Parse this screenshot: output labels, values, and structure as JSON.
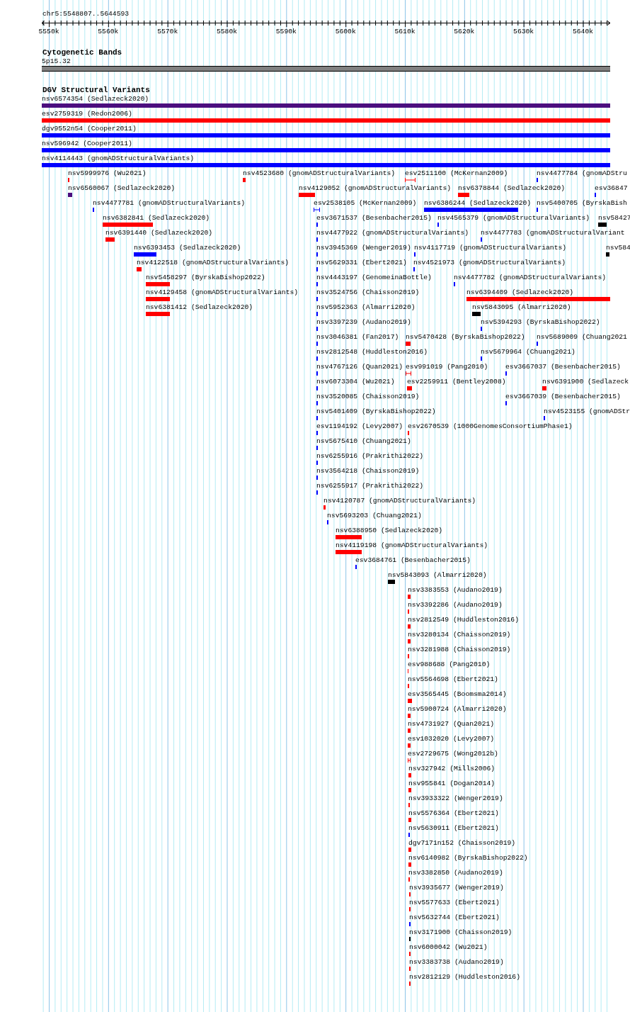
{
  "view": {
    "locus": "chr5:5548807..5644593"
  },
  "ruler": {
    "ticks": [
      "5550k",
      "5560k",
      "5570k",
      "5580k",
      "5590k",
      "5600k",
      "5610k",
      "5620k",
      "5630k",
      "5640k"
    ]
  },
  "cytobands": {
    "title": "Cytogenetic Bands",
    "bands": [
      {
        "label": "5p15.32",
        "color": "#808080"
      }
    ]
  },
  "variants": {
    "title": "DGV Structural Variants",
    "rows": [
      [
        {
          "label": "nsv6574354 (Sedlazeck2020)",
          "color": "#4b0f7f",
          "kind": "bar"
        }
      ],
      [
        {
          "label": "esv2759319 (Redon2006)",
          "color": "#ff0000",
          "kind": "bar"
        }
      ],
      [
        {
          "label": "dgv9552n54 (Cooper2011)",
          "color": "#0000ff",
          "kind": "bar"
        }
      ],
      [
        {
          "label": "nsv596942 (Cooper2011)",
          "color": "#0000ff",
          "kind": "bar"
        }
      ],
      [
        {
          "label": "nsv4114443 (gnomADStructuralVariants)",
          "color": "#0000ff",
          "kind": "bar"
        }
      ],
      [
        {
          "label": "nsv5999976 (Wu2021)",
          "color": "#ff0000",
          "kind": "bar"
        },
        {
          "label": "nsv4523680 (gnomADStructuralVariants)",
          "color": "#ff0000",
          "kind": "bar"
        },
        {
          "label": "esv2511100 (McKernan2009)",
          "color": "#ff0000",
          "kind": "range"
        },
        {
          "label": "nsv4477784 (gnomADStru",
          "color": "#0000ff",
          "kind": "bar"
        }
      ],
      [
        {
          "label": "nsv6560067 (Sedlazeck2020)",
          "color": "#4b0f7f",
          "kind": "bar"
        },
        {
          "label": "nsv4129052 (gnomADStructuralVariants)",
          "color": "#ff0000",
          "kind": "bar"
        },
        {
          "label": "nsv6378844 (Sedlazeck2020)",
          "color": "#ff0000",
          "kind": "bar"
        },
        {
          "label": "esv36847",
          "color": "#0000ff",
          "kind": "bar"
        }
      ],
      [
        {
          "label": "nsv4477781 (gnomADStructuralVariants)",
          "color": "#0000ff",
          "kind": "bar"
        },
        {
          "label": "esv2538105 (McKernan2009)",
          "color": "#0000ff",
          "kind": "range"
        },
        {
          "label": "nsv6386244 (Sedlazeck2020)",
          "color": "#0000ff",
          "kind": "bar"
        },
        {
          "label": "nsv5400705 (ByrskaBish",
          "color": "#0000ff",
          "kind": "bar"
        }
      ],
      [
        {
          "label": "nsv6382841 (Sedlazeck2020)",
          "color": "#ff0000",
          "kind": "bar"
        },
        {
          "label": "esv3671537 (Besenbacher2015)",
          "color": "#0000ff",
          "kind": "bar"
        },
        {
          "label": "nsv4565379 (gnomADStructuralVariants)",
          "color": "#0000ff",
          "kind": "bar"
        },
        {
          "label": "nsv58427",
          "color": "#000000",
          "kind": "bar"
        }
      ],
      [
        {
          "label": "nsv6391440 (Sedlazeck2020)",
          "color": "#ff0000",
          "kind": "bar"
        },
        {
          "label": "nsv4477922 (gnomADStructuralVariants)",
          "color": "#0000ff",
          "kind": "bar"
        },
        {
          "label": "nsv4477783 (gnomADStructuralVariant",
          "color": "#0000ff",
          "kind": "bar"
        }
      ],
      [
        {
          "label": "nsv6393453 (Sedlazeck2020)",
          "color": "#0000ff",
          "kind": "bar"
        },
        {
          "label": "nsv3945369 (Wenger2019)",
          "color": "#0000ff",
          "kind": "bar"
        },
        {
          "label": "nsv4117719 (gnomADStructuralVariants)",
          "color": "#0000ff",
          "kind": "bar"
        },
        {
          "label": "nsv584",
          "color": "#000000",
          "kind": "bar"
        }
      ],
      [
        {
          "label": "nsv4122518 (gnomADStructuralVariants)",
          "color": "#ff0000",
          "kind": "bar"
        },
        {
          "label": "nsv5629331 (Ebert2021)",
          "color": "#0000ff",
          "kind": "bar"
        },
        {
          "label": "nsv4521973 (gnomADStructuralVariants)",
          "color": "#0000ff",
          "kind": "bar"
        }
      ],
      [
        {
          "label": "nsv5458297 (ByrskaBishop2022)",
          "color": "#ff0000",
          "kind": "bar"
        },
        {
          "label": "nsv4443197 (GenomeinaBottle)",
          "color": "#0000ff",
          "kind": "bar"
        },
        {
          "label": "nsv4477782 (gnomADStructuralVariants)",
          "color": "#0000ff",
          "kind": "bar"
        }
      ],
      [
        {
          "label": "nsv4129458 (gnomADStructuralVariants)",
          "color": "#ff0000",
          "kind": "bar"
        },
        {
          "label": "nsv3524756 (Chaisson2019)",
          "color": "#0000ff",
          "kind": "bar"
        },
        {
          "label": "nsv6394409 (Sedlazeck2020)",
          "color": "#ff0000",
          "kind": "bar"
        }
      ],
      [
        {
          "label": "nsv6381412 (Sedlazeck2020)",
          "color": "#ff0000",
          "kind": "bar"
        },
        {
          "label": "nsv5952363 (Almarri2020)",
          "color": "#0000ff",
          "kind": "bar"
        },
        {
          "label": "nsv5843095 (Almarri2020)",
          "color": "#000000",
          "kind": "bar"
        }
      ],
      [
        {
          "label": "nsv3397239 (Audano2019)",
          "color": "#0000ff",
          "kind": "bar"
        },
        {
          "label": "nsv5394293 (ByrskaBishop2022)",
          "color": "#0000ff",
          "kind": "bar"
        }
      ],
      [
        {
          "label": "nsv3046381 (Fan2017)",
          "color": "#0000ff",
          "kind": "bar"
        },
        {
          "label": "nsv5470428 (ByrskaBishop2022)",
          "color": "#ff0000",
          "kind": "bar"
        },
        {
          "label": "nsv5689009 (Chuang2021",
          "color": "#0000ff",
          "kind": "bar"
        }
      ],
      [
        {
          "label": "nsv2812548 (Huddleston2016)",
          "color": "#0000ff",
          "kind": "bar"
        },
        {
          "label": "nsv5679964 (Chuang2021)",
          "color": "#0000ff",
          "kind": "bar"
        }
      ],
      [
        {
          "label": "nsv4767126 (Quan2021)",
          "color": "#0000ff",
          "kind": "bar"
        },
        {
          "label": "esv991019 (Pang2010)",
          "color": "#ff0000",
          "kind": "range"
        },
        {
          "label": "esv3667037 (Besenbacher2015)",
          "color": "#0000ff",
          "kind": "bar"
        }
      ],
      [
        {
          "label": "nsv6073304 (Wu2021)",
          "color": "#0000ff",
          "kind": "bar"
        },
        {
          "label": "esv2259911 (Bentley2008)",
          "color": "#ff0000",
          "kind": "bar"
        },
        {
          "label": "nsv6391900 (Sedlazeck",
          "color": "#ff0000",
          "kind": "bar"
        }
      ],
      [
        {
          "label": "nsv3520085 (Chaisson2019)",
          "color": "#0000ff",
          "kind": "bar"
        },
        {
          "label": "esv3667039 (Besenbacher2015)",
          "color": "#0000ff",
          "kind": "bar"
        }
      ],
      [
        {
          "label": "nsv5401409 (ByrskaBishop2022)",
          "color": "#0000ff",
          "kind": "bar"
        },
        {
          "label": "nsv4523155 (gnomADStr",
          "color": "#0000ff",
          "kind": "bar"
        }
      ],
      [
        {
          "label": "esv1194192 (Levy2007)",
          "color": "#0000ff",
          "kind": "bar"
        },
        {
          "label": "esv2670539 (1000GenomesConsortiumPhase1)",
          "color": "#ff0000",
          "kind": "bar"
        }
      ],
      [
        {
          "label": "nsv5675410 (Chuang2021)",
          "color": "#0000ff",
          "kind": "bar"
        }
      ],
      [
        {
          "label": "nsv6255916 (Prakrithi2022)",
          "color": "#0000ff",
          "kind": "bar"
        }
      ],
      [
        {
          "label": "nsv3564218 (Chaisson2019)",
          "color": "#0000ff",
          "kind": "bar"
        }
      ],
      [
        {
          "label": "nsv6255917 (Prakrithi2022)",
          "color": "#0000ff",
          "kind": "bar"
        }
      ],
      [
        {
          "label": "nsv4120787 (gnomADStructuralVariants)",
          "color": "#ff0000",
          "kind": "bar"
        }
      ],
      [
        {
          "label": "nsv5693203 (Chuang2021)",
          "color": "#0000ff",
          "kind": "bar"
        }
      ],
      [
        {
          "label": "nsv6388950 (Sedlazeck2020)",
          "color": "#ff0000",
          "kind": "bar"
        }
      ],
      [
        {
          "label": "nsv4119198 (gnomADStructuralVariants)",
          "color": "#ff0000",
          "kind": "bar"
        }
      ],
      [
        {
          "label": "esv3684761 (Besenbacher2015)",
          "color": "#0000ff",
          "kind": "bar"
        }
      ],
      [
        {
          "label": "nsv5843093 (Almarri2020)",
          "color": "#000000",
          "kind": "bar"
        }
      ],
      [
        {
          "label": "nsv3383553 (Audano2019)",
          "color": "#ff0000",
          "kind": "bar"
        }
      ],
      [
        {
          "label": "nsv3392286 (Audano2019)",
          "color": "#ff0000",
          "kind": "bar"
        }
      ],
      [
        {
          "label": "nsv2812549 (Huddleston2016)",
          "color": "#ff0000",
          "kind": "bar"
        }
      ],
      [
        {
          "label": "nsv3280134 (Chaisson2019)",
          "color": "#ff0000",
          "kind": "bar"
        }
      ],
      [
        {
          "label": "nsv3281988 (Chaisson2019)",
          "color": "#ff0000",
          "kind": "bar"
        }
      ],
      [
        {
          "label": "esv988688 (Pang2010)",
          "color": "#ff0000",
          "kind": "bar"
        }
      ],
      [
        {
          "label": "nsv5564698 (Ebert2021)",
          "color": "#ff0000",
          "kind": "bar"
        }
      ],
      [
        {
          "label": "esv3565445 (Boomsma2014)",
          "color": "#ff0000",
          "kind": "bar"
        }
      ],
      [
        {
          "label": "nsv5900724 (Almarri2020)",
          "color": "#ff0000",
          "kind": "bar"
        }
      ],
      [
        {
          "label": "nsv4731927 (Quan2021)",
          "color": "#ff0000",
          "kind": "bar"
        }
      ],
      [
        {
          "label": "esv1032020 (Levy2007)",
          "color": "#ff0000",
          "kind": "bar"
        }
      ],
      [
        {
          "label": "esv2729675 (Wong2012b)",
          "color": "#ff0000",
          "kind": "range"
        }
      ],
      [
        {
          "label": "nsv327942 (Mills2006)",
          "color": "#ff0000",
          "kind": "bar"
        }
      ],
      [
        {
          "label": "nsv955841 (Dogan2014)",
          "color": "#ff0000",
          "kind": "bar"
        }
      ],
      [
        {
          "label": "nsv3933322 (Wenger2019)",
          "color": "#ff0000",
          "kind": "bar"
        }
      ],
      [
        {
          "label": "nsv5576364 (Ebert2021)",
          "color": "#ff0000",
          "kind": "bar"
        }
      ],
      [
        {
          "label": "nsv5630911 (Ebert2021)",
          "color": "#0000ff",
          "kind": "bar"
        }
      ],
      [
        {
          "label": "dgv7171n152 (Chaisson2019)",
          "color": "#ff0000",
          "kind": "bar"
        }
      ],
      [
        {
          "label": "nsv6140982 (ByrskaBishop2022)",
          "color": "#ff0000",
          "kind": "bar"
        }
      ],
      [
        {
          "label": "nsv3382850 (Audano2019)",
          "color": "#ff0000",
          "kind": "bar"
        }
      ],
      [
        {
          "label": "nsv3935677 (Wenger2019)",
          "color": "#ff0000",
          "kind": "bar"
        }
      ],
      [
        {
          "label": "nsv5577633 (Ebert2021)",
          "color": "#ff0000",
          "kind": "bar"
        }
      ],
      [
        {
          "label": "nsv5632744 (Ebert2021)",
          "color": "#0000ff",
          "kind": "bar"
        }
      ],
      [
        {
          "label": "nsv3171900 (Chaisson2019)",
          "color": "#000000",
          "kind": "bar"
        }
      ],
      [
        {
          "label": "nsv6000042 (Wu2021)",
          "color": "#ff0000",
          "kind": "bar"
        }
      ],
      [
        {
          "label": "nsv3383738 (Audano2019)",
          "color": "#ff0000",
          "kind": "bar"
        }
      ],
      [
        {
          "label": "nsv2812129 (Huddleston2016)",
          "color": "#ff0000",
          "kind": "bar"
        }
      ]
    ]
  }
}
